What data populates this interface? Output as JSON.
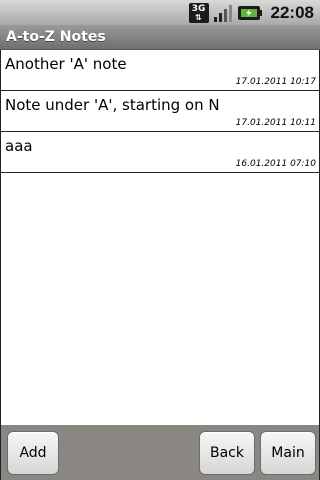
{
  "status_bar": {
    "network_label": "3G",
    "time": "22:08",
    "icons": [
      "3g-data-icon",
      "signal-strength-icon",
      "battery-charging-icon"
    ]
  },
  "app": {
    "title": "A-to-Z Notes"
  },
  "notes": [
    {
      "title": "Another 'A' note",
      "date": "17.01.2011 10:17"
    },
    {
      "title": "Note under 'A', starting on N",
      "date": "17.01.2011 10:11"
    },
    {
      "title": "aaa",
      "date": "16.01.2011 07:10"
    }
  ],
  "buttons": {
    "add": "Add",
    "back": "Back",
    "main": "Main"
  },
  "colors": {
    "title_bar": "#7f7f7f",
    "bottom_bar": "#8a8782",
    "battery_fill": "#5fb33a"
  }
}
